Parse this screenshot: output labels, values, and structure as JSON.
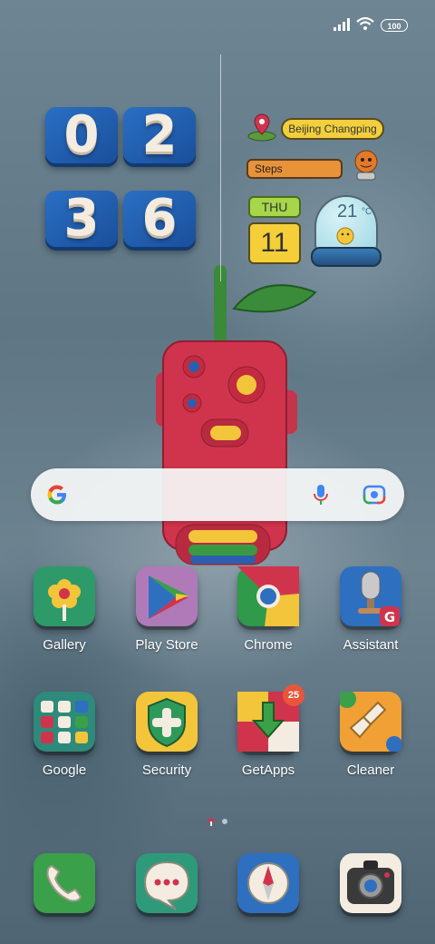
{
  "status_bar": {
    "battery": "100"
  },
  "clock": {
    "digits": [
      "0",
      "2",
      "3",
      "6"
    ]
  },
  "widgets": {
    "location": "Beijing Changping",
    "steps_label": "Steps",
    "weekday": "THU",
    "day": "11",
    "temperature": "21",
    "temp_unit": "°C"
  },
  "apps_row1": [
    {
      "label": "Gallery",
      "icon": "gallery-icon"
    },
    {
      "label": "Play Store",
      "icon": "play-store-icon"
    },
    {
      "label": "Chrome",
      "icon": "chrome-icon"
    },
    {
      "label": "Assistant",
      "icon": "assistant-icon"
    }
  ],
  "apps_row2": [
    {
      "label": "Google",
      "icon": "google-folder-icon"
    },
    {
      "label": "Security",
      "icon": "security-icon"
    },
    {
      "label": "GetApps",
      "icon": "getapps-icon",
      "badge": "25"
    },
    {
      "label": "Cleaner",
      "icon": "cleaner-icon"
    }
  ],
  "dock": [
    {
      "icon": "phone-icon"
    },
    {
      "icon": "messages-icon"
    },
    {
      "icon": "browser-icon"
    },
    {
      "icon": "camera-icon"
    }
  ],
  "colors": {
    "clock_block": "#2a6fc4",
    "accent_red": "#d0334a",
    "badge": "#e8553a"
  }
}
